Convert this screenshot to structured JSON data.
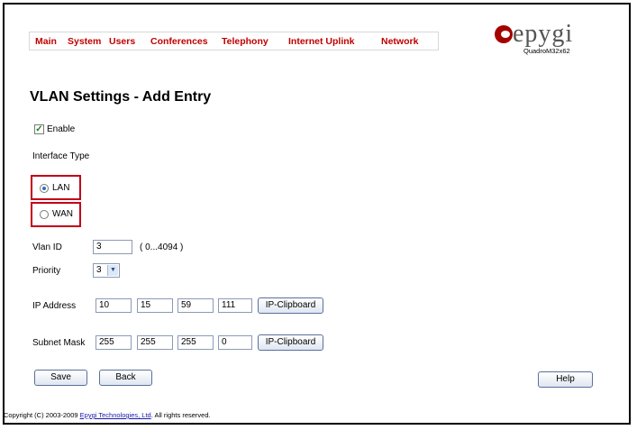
{
  "nav": {
    "items": [
      "Main",
      "System",
      "Users",
      "Conferences",
      "Telephony",
      "Internet Uplink",
      "Network"
    ]
  },
  "brand": {
    "word": "epygi",
    "model": "QuadroM32x62"
  },
  "page": {
    "title": "VLAN Settings - Add Entry"
  },
  "form": {
    "enable_label": "Enable",
    "enable_checked": true,
    "interface_type_label": "Interface Type",
    "lan_label": "LAN",
    "wan_label": "WAN",
    "selected_interface": "LAN",
    "vlan_id_label": "Vlan ID",
    "vlan_id_value": "3",
    "vlan_id_range": "( 0...4094 )",
    "priority_label": "Priority",
    "priority_value": "3",
    "ip_label": "IP Address",
    "ip": [
      "10",
      "15",
      "59",
      "111"
    ],
    "subnet_label": "Subnet Mask",
    "subnet": [
      "255",
      "255",
      "255",
      "0"
    ],
    "clipboard_label": "IP-Clipboard"
  },
  "buttons": {
    "save": "Save",
    "back": "Back",
    "help": "Help"
  },
  "footer": {
    "prefix": "Copyright (C) 2003-2009 ",
    "link": "Epygi Technologies, Ltd",
    "suffix": ". All rights reserved."
  },
  "colors": {
    "nav_text": "#c00000",
    "highlight_border": "#c0001a",
    "brand": "#a50000"
  }
}
